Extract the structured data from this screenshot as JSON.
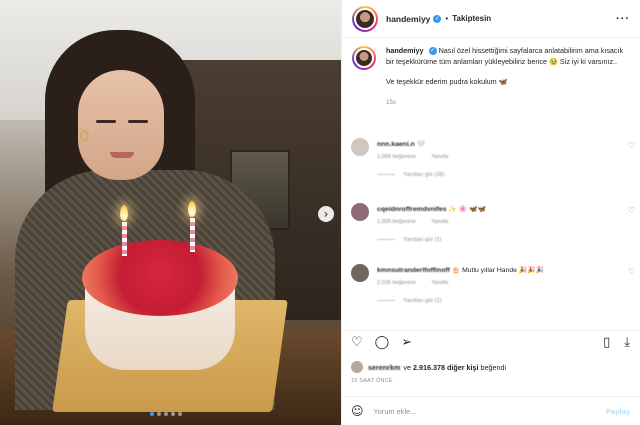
{
  "photo": {
    "alt_subject": "woman with birthday cake",
    "carousel_total": 5,
    "carousel_active": 1,
    "next_icon": "chevron-right-icon"
  },
  "header": {
    "username": "handemiyy",
    "separator": "•",
    "follow_label": "Takiptesin",
    "more_icon": "more-horizontal-icon"
  },
  "caption": {
    "username": "handemiyy",
    "text1": "Nasıl özel hissettiğimi sayfalarca anlatabilirim ama kısacık bir teşekkürüme tüm anlamları yükleyebiliriz bence 🥹 Siz iyi ki varsınız..",
    "text2": "Ve teşekkür ederim pudra kokulum 🦋",
    "time": "15s"
  },
  "comments": [
    {
      "username": "nnn.kaeni.n",
      "text": "🤍",
      "likes": "1.056 beğenme",
      "reply": "Yanıtla",
      "replies": "Yanıtları gör (28)"
    },
    {
      "username": "cqeidnroffremdvnifes",
      "text": "✨ 🌸 🦋🦋",
      "likes": "1.005 beğenme",
      "reply": "Yanıtla",
      "replies": "Yanıtları gör (1)"
    },
    {
      "username": "kmnsutranderlfoffinoff",
      "text": "🎂 Mutlu yıllar Hande 🎉🎉🎉",
      "likes": "2.035 beğenme",
      "reply": "Yanıtla",
      "replies": "Yanıtları gör (1)"
    }
  ],
  "actions": {
    "like_icon": "heart-icon",
    "comment_icon": "comment-icon",
    "share_icon": "send-icon",
    "save_icon": "bookmark-icon",
    "download_icon": "download-icon"
  },
  "likes": {
    "liker": "serenrkm",
    "connector": "ve",
    "count_text": "2.916.378 diğer kişi",
    "suffix": "beğendi"
  },
  "posted_time": "15 SAAT ÖNCE",
  "add_comment": {
    "emoji_icon": "smiley-icon",
    "placeholder": "Yorum ekle...",
    "post_label": "Paylaş",
    "post_color": "#b2dffc"
  },
  "colors": {
    "verified": "#3897f0",
    "text": "#262626",
    "muted": "#8e8e8e"
  }
}
